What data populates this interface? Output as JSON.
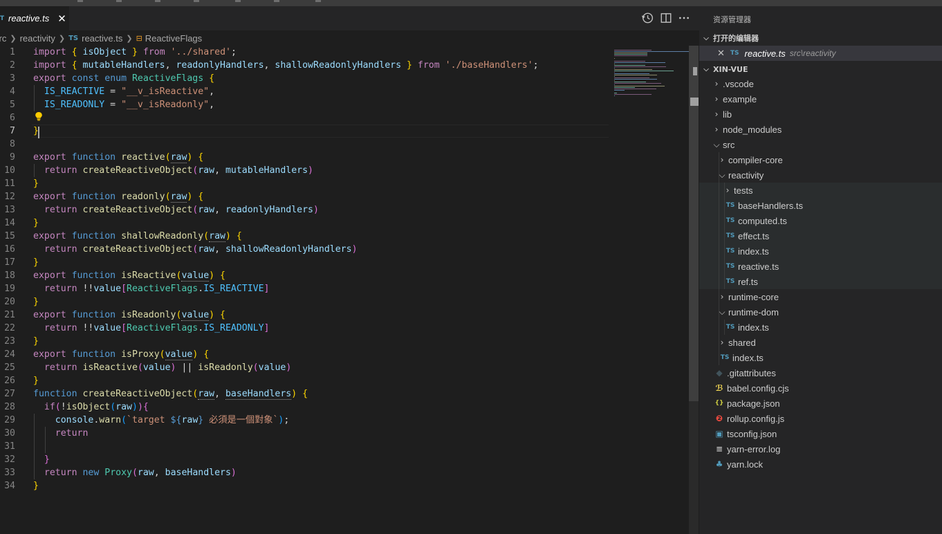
{
  "editor": {
    "tab": {
      "label": "reactive.ts",
      "close": "✕"
    },
    "breadcrumb": {
      "part0": "src",
      "part1": "reactivity",
      "part2": "reactive.ts",
      "part3": "ReactiveFlags"
    }
  },
  "explorer": {
    "title": "资源管理器",
    "open_editors_title": "打开的编辑器",
    "open_editor": {
      "name": "reactive.ts",
      "description": "src\\reactivity"
    },
    "workspace_title": "XIN-VUE",
    "tree": [
      {
        "label": ".vscode",
        "kind": "folder",
        "expanded": false
      },
      {
        "label": "example",
        "kind": "folder",
        "expanded": false
      },
      {
        "label": "lib",
        "kind": "folder",
        "expanded": false
      },
      {
        "label": "node_modules",
        "kind": "folder",
        "expanded": false
      },
      {
        "label": "src",
        "kind": "folder",
        "expanded": true
      },
      {
        "label": "compiler-core",
        "kind": "folder",
        "expanded": false
      },
      {
        "label": "reactivity",
        "kind": "folder",
        "expanded": true
      },
      {
        "label": "tests",
        "kind": "folder",
        "expanded": false
      },
      {
        "label": "baseHandlers.ts",
        "kind": "ts"
      },
      {
        "label": "computed.ts",
        "kind": "ts"
      },
      {
        "label": "effect.ts",
        "kind": "ts"
      },
      {
        "label": "index.ts",
        "kind": "ts"
      },
      {
        "label": "reactive.ts",
        "kind": "ts"
      },
      {
        "label": "ref.ts",
        "kind": "ts"
      },
      {
        "label": "runtime-core",
        "kind": "folder",
        "expanded": false
      },
      {
        "label": "runtime-dom",
        "kind": "folder",
        "expanded": true
      },
      {
        "label": "index.ts",
        "kind": "ts"
      },
      {
        "label": "shared",
        "kind": "folder",
        "expanded": false
      },
      {
        "label": "index.ts",
        "kind": "ts"
      },
      {
        "label": ".gitattributes",
        "kind": "git"
      },
      {
        "label": "babel.config.cjs",
        "kind": "babel"
      },
      {
        "label": "package.json",
        "kind": "json"
      },
      {
        "label": "rollup.config.js",
        "kind": "rollup"
      },
      {
        "label": "tsconfig.json",
        "kind": "tsconfig"
      },
      {
        "label": "yarn-error.log",
        "kind": "log"
      },
      {
        "label": "yarn.lock",
        "kind": "yarn"
      }
    ]
  },
  "code": {
    "line_numbers": [
      "1",
      "2",
      "3",
      "4",
      "5",
      "6",
      "7",
      "8",
      "9",
      "10",
      "11",
      "12",
      "13",
      "14",
      "15",
      "16",
      "17",
      "18",
      "19",
      "20",
      "21",
      "22",
      "23",
      "24",
      "25",
      "26",
      "27",
      "28",
      "29",
      "30",
      "31",
      "32",
      "33",
      "34"
    ],
    "lines": [
      [
        [
          "kc",
          "import"
        ],
        [
          "pu",
          " "
        ],
        [
          "b1",
          "{"
        ],
        [
          "pu",
          " "
        ],
        [
          "va",
          "isObject"
        ],
        [
          "pu",
          " "
        ],
        [
          "b1",
          "}"
        ],
        [
          "pu",
          " "
        ],
        [
          "kc",
          "from"
        ],
        [
          "pu",
          " "
        ],
        [
          "st",
          "'../shared'"
        ],
        [
          "pu",
          ";"
        ]
      ],
      [
        [
          "kc",
          "import"
        ],
        [
          "pu",
          " "
        ],
        [
          "b1",
          "{"
        ],
        [
          "pu",
          " "
        ],
        [
          "va",
          "mutableHandlers"
        ],
        [
          "pu",
          ", "
        ],
        [
          "va",
          "readonlyHandlers"
        ],
        [
          "pu",
          ", "
        ],
        [
          "va",
          "shallowReadonlyHandlers"
        ],
        [
          "pu",
          " "
        ],
        [
          "b1",
          "}"
        ],
        [
          "pu",
          " "
        ],
        [
          "kc",
          "from"
        ],
        [
          "pu",
          " "
        ],
        [
          "st",
          "'./baseHandlers'"
        ],
        [
          "pu",
          ";"
        ]
      ],
      [
        [
          "kc",
          "export"
        ],
        [
          "pu",
          " "
        ],
        [
          "kw",
          "const"
        ],
        [
          "pu",
          " "
        ],
        [
          "kw",
          "enum"
        ],
        [
          "pu",
          " "
        ],
        [
          "ty",
          "ReactiveFlags"
        ],
        [
          "pu",
          " "
        ],
        [
          "b1",
          "{"
        ]
      ],
      [
        [
          "pu",
          "  "
        ],
        [
          "cn",
          "IS_REACTIVE"
        ],
        [
          "pu",
          " = "
        ],
        [
          "st",
          "\"__v_isReactive\""
        ],
        [
          "pu",
          ","
        ]
      ],
      [
        [
          "pu",
          "  "
        ],
        [
          "cn",
          "IS_READONLY"
        ],
        [
          "pu",
          " = "
        ],
        [
          "st",
          "\"__v_isReadonly\""
        ],
        [
          "pu",
          ","
        ]
      ],
      [
        [
          "pu",
          ""
        ]
      ],
      [
        [
          "b1",
          "}"
        ]
      ],
      [
        [
          "pu",
          ""
        ]
      ],
      [
        [
          "kc",
          "export"
        ],
        [
          "pu",
          " "
        ],
        [
          "kw",
          "function"
        ],
        [
          "pu",
          " "
        ],
        [
          "fn",
          "reactive"
        ],
        [
          "b1",
          "("
        ],
        [
          "va dot",
          "raw"
        ],
        [
          "b1",
          ")"
        ],
        [
          "pu",
          " "
        ],
        [
          "b1",
          "{"
        ]
      ],
      [
        [
          "pu",
          "  "
        ],
        [
          "kc",
          "return"
        ],
        [
          "pu",
          " "
        ],
        [
          "fn",
          "createReactiveObject"
        ],
        [
          "b2",
          "("
        ],
        [
          "va",
          "raw"
        ],
        [
          "pu",
          ", "
        ],
        [
          "va",
          "mutableHandlers"
        ],
        [
          "b2",
          ")"
        ]
      ],
      [
        [
          "b1",
          "}"
        ]
      ],
      [
        [
          "kc",
          "export"
        ],
        [
          "pu",
          " "
        ],
        [
          "kw",
          "function"
        ],
        [
          "pu",
          " "
        ],
        [
          "fn",
          "readonly"
        ],
        [
          "b1",
          "("
        ],
        [
          "va dot",
          "raw"
        ],
        [
          "b1",
          ")"
        ],
        [
          "pu",
          " "
        ],
        [
          "b1",
          "{"
        ]
      ],
      [
        [
          "pu",
          "  "
        ],
        [
          "kc",
          "return"
        ],
        [
          "pu",
          " "
        ],
        [
          "fn",
          "createReactiveObject"
        ],
        [
          "b2",
          "("
        ],
        [
          "va",
          "raw"
        ],
        [
          "pu",
          ", "
        ],
        [
          "va",
          "readonlyHandlers"
        ],
        [
          "b2",
          ")"
        ]
      ],
      [
        [
          "b1",
          "}"
        ]
      ],
      [
        [
          "kc",
          "export"
        ],
        [
          "pu",
          " "
        ],
        [
          "kw",
          "function"
        ],
        [
          "pu",
          " "
        ],
        [
          "fn",
          "shallowReadonly"
        ],
        [
          "b1",
          "("
        ],
        [
          "va dot",
          "raw"
        ],
        [
          "b1",
          ")"
        ],
        [
          "pu",
          " "
        ],
        [
          "b1",
          "{"
        ]
      ],
      [
        [
          "pu",
          "  "
        ],
        [
          "kc",
          "return"
        ],
        [
          "pu",
          " "
        ],
        [
          "fn",
          "createReactiveObject"
        ],
        [
          "b2",
          "("
        ],
        [
          "va",
          "raw"
        ],
        [
          "pu",
          ", "
        ],
        [
          "va",
          "shallowReadonlyHandlers"
        ],
        [
          "b2",
          ")"
        ]
      ],
      [
        [
          "b1",
          "}"
        ]
      ],
      [
        [
          "kc",
          "export"
        ],
        [
          "pu",
          " "
        ],
        [
          "kw",
          "function"
        ],
        [
          "pu",
          " "
        ],
        [
          "fn",
          "isReactive"
        ],
        [
          "b1",
          "("
        ],
        [
          "va dot",
          "value"
        ],
        [
          "b1",
          ")"
        ],
        [
          "pu",
          " "
        ],
        [
          "b1",
          "{"
        ]
      ],
      [
        [
          "pu",
          "  "
        ],
        [
          "kc",
          "return"
        ],
        [
          "pu",
          " !!"
        ],
        [
          "va",
          "value"
        ],
        [
          "b2",
          "["
        ],
        [
          "ty",
          "ReactiveFlags"
        ],
        [
          "pu",
          "."
        ],
        [
          "cn",
          "IS_REACTIVE"
        ],
        [
          "b2",
          "]"
        ]
      ],
      [
        [
          "b1",
          "}"
        ]
      ],
      [
        [
          "kc",
          "export"
        ],
        [
          "pu",
          " "
        ],
        [
          "kw",
          "function"
        ],
        [
          "pu",
          " "
        ],
        [
          "fn",
          "isReadonly"
        ],
        [
          "b1",
          "("
        ],
        [
          "va dot",
          "value"
        ],
        [
          "b1",
          ")"
        ],
        [
          "pu",
          " "
        ],
        [
          "b1",
          "{"
        ]
      ],
      [
        [
          "pu",
          "  "
        ],
        [
          "kc",
          "return"
        ],
        [
          "pu",
          " !!"
        ],
        [
          "va",
          "value"
        ],
        [
          "b2",
          "["
        ],
        [
          "ty",
          "ReactiveFlags"
        ],
        [
          "pu",
          "."
        ],
        [
          "cn",
          "IS_READONLY"
        ],
        [
          "b2",
          "]"
        ]
      ],
      [
        [
          "b1",
          "}"
        ]
      ],
      [
        [
          "kc",
          "export"
        ],
        [
          "pu",
          " "
        ],
        [
          "kw",
          "function"
        ],
        [
          "pu",
          " "
        ],
        [
          "fn",
          "isProxy"
        ],
        [
          "b1",
          "("
        ],
        [
          "va dot",
          "value"
        ],
        [
          "b1",
          ")"
        ],
        [
          "pu",
          " "
        ],
        [
          "b1",
          "{"
        ]
      ],
      [
        [
          "pu",
          "  "
        ],
        [
          "kc",
          "return"
        ],
        [
          "pu",
          " "
        ],
        [
          "fn",
          "isReactive"
        ],
        [
          "b2",
          "("
        ],
        [
          "va",
          "value"
        ],
        [
          "b2",
          ")"
        ],
        [
          "pu",
          " || "
        ],
        [
          "fn",
          "isReadonly"
        ],
        [
          "b2",
          "("
        ],
        [
          "va",
          "value"
        ],
        [
          "b2",
          ")"
        ]
      ],
      [
        [
          "b1",
          "}"
        ]
      ],
      [
        [
          "kw",
          "function"
        ],
        [
          "pu",
          " "
        ],
        [
          "fn",
          "createReactiveObject"
        ],
        [
          "b1",
          "("
        ],
        [
          "va dot",
          "raw"
        ],
        [
          "pu",
          ", "
        ],
        [
          "va dot",
          "baseHandlers"
        ],
        [
          "b1",
          ")"
        ],
        [
          "pu",
          " "
        ],
        [
          "b1",
          "{"
        ]
      ],
      [
        [
          "pu",
          "  "
        ],
        [
          "kc",
          "if"
        ],
        [
          "b2",
          "("
        ],
        [
          "pu",
          "!"
        ],
        [
          "fn",
          "isObject"
        ],
        [
          "b3",
          "("
        ],
        [
          "va",
          "raw"
        ],
        [
          "b3",
          ")"
        ],
        [
          "b2",
          ")"
        ],
        [
          "b2",
          "{"
        ]
      ],
      [
        [
          "pu",
          "    "
        ],
        [
          "va",
          "console"
        ],
        [
          "pu",
          "."
        ],
        [
          "fn",
          "warn"
        ],
        [
          "b3",
          "("
        ],
        [
          "st",
          "`target "
        ],
        [
          "kw",
          "${"
        ],
        [
          "va",
          "raw"
        ],
        [
          "kw",
          "}"
        ],
        [
          "st",
          " 必須是一個對象`"
        ],
        [
          "b3",
          ")"
        ],
        [
          "pu",
          ";"
        ]
      ],
      [
        [
          "pu",
          "    "
        ],
        [
          "kc",
          "return"
        ]
      ],
      [
        [
          "pu",
          ""
        ]
      ],
      [
        [
          "pu",
          "  "
        ],
        [
          "b2",
          "}"
        ]
      ],
      [
        [
          "pu",
          "  "
        ],
        [
          "kc",
          "return"
        ],
        [
          "pu",
          " "
        ],
        [
          "kw",
          "new"
        ],
        [
          "pu",
          " "
        ],
        [
          "ty",
          "Proxy"
        ],
        [
          "b2",
          "("
        ],
        [
          "va",
          "raw"
        ],
        [
          "pu",
          ", "
        ],
        [
          "va",
          "baseHandlers"
        ],
        [
          "b2",
          ")"
        ]
      ],
      [
        [
          "b1",
          "}"
        ]
      ]
    ]
  },
  "colors": {
    "editor_bg": "#1e1e1e",
    "sidebar_bg": "#252526",
    "ts_icon": "#519aba"
  }
}
